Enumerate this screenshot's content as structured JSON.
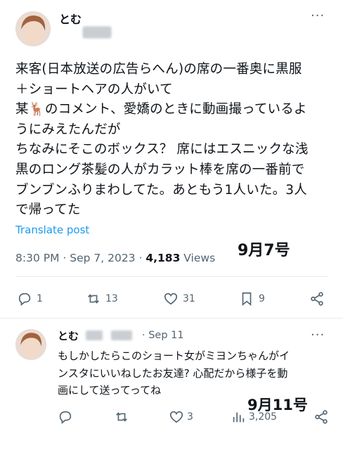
{
  "post": {
    "author_name": "とむ",
    "text": "来客(日本放送の広告らへん)の席の一番奥に黒服\n＋ショートヘアの人がいて\n某🦌のコメント、愛嬌のときに動画撮っているよ\nうにみえたんだが\nちなみにそこのボックス？ 席にはエスニックな浅\n黒のロング茶髪の人がカラット棒を席の一番前で\nブンブンふりまわしてた。あともう1人いた。3人\nで帰ってた",
    "translate_label": "Translate post",
    "time": "8:30 PM · Sep 7, 2023 · ",
    "views_count": "4,183",
    "views_label": " Views",
    "annotation": "9月7号",
    "actions": {
      "replies": "1",
      "reposts": "13",
      "likes": "31",
      "bookmarks": "9"
    },
    "more_label": "···"
  },
  "reply": {
    "author_name": "とむ",
    "date": "· Sep 11",
    "text": "もしかしたらこのショート女がミヨンちゃんがイ\nンスタにいいねしたお友達? 心配だから様子を動\n画にして送ってってね",
    "annotation": "9月11号",
    "actions": {
      "likes": "3",
      "views": "3,205"
    },
    "more_label": "···"
  },
  "icons": [
    "reply-icon",
    "repost-icon",
    "like-icon",
    "bookmark-icon",
    "share-icon",
    "views-icon"
  ]
}
